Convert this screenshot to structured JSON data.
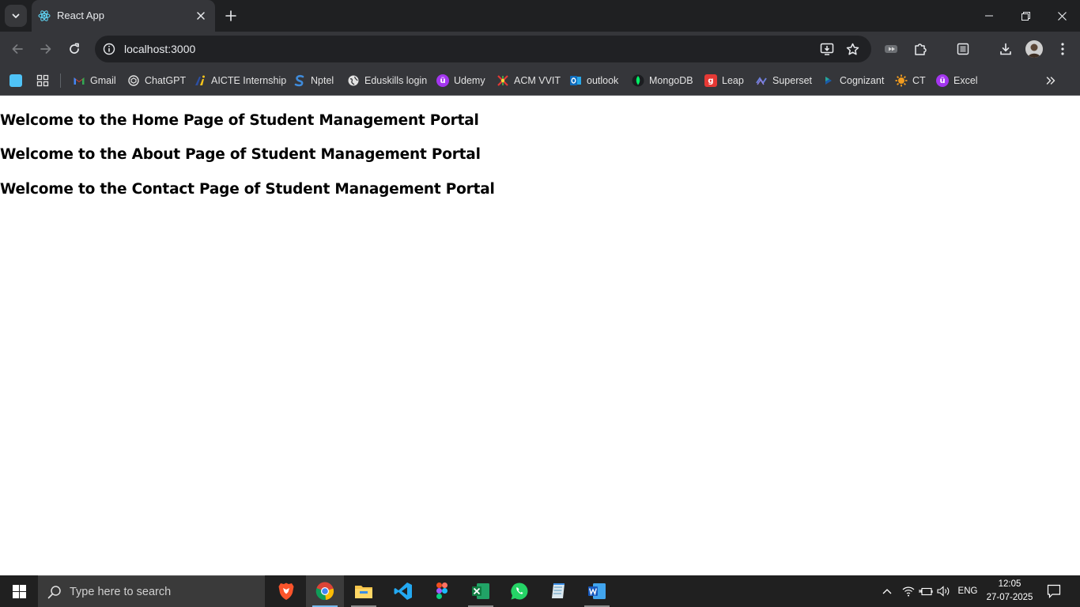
{
  "browser": {
    "tab": {
      "title": "React App",
      "favicon": "react-logo-icon"
    },
    "address": {
      "url": "localhost:3000"
    },
    "bookmarks": [
      {
        "label": "",
        "icon": "app-square-icon",
        "color": "#4fc3f7"
      },
      {
        "label": "",
        "icon": "apps-grid-icon",
        "color": "#e3e3e3"
      },
      {
        "label": "Gmail",
        "icon": "gmail-icon",
        "color": "#ea4335"
      },
      {
        "label": "ChatGPT",
        "icon": "chatgpt-icon",
        "color": "#e3e3e3"
      },
      {
        "label": "AICTE Internship",
        "icon": "aicte-icon",
        "color": "#f9c51c"
      },
      {
        "label": "Nptel",
        "icon": "nptel-icon",
        "color": "#3f8bdb"
      },
      {
        "label": "Eduskills login",
        "icon": "globe-icon",
        "color": "#e3e3e3"
      },
      {
        "label": "Udemy",
        "icon": "udemy-icon",
        "color": "#a435f0"
      },
      {
        "label": "ACM VVIT",
        "icon": "acm-icon",
        "color": "#2e7d32"
      },
      {
        "label": "outlook",
        "icon": "outlook-icon",
        "color": "#0f6cbd"
      },
      {
        "label": "MongoDB",
        "icon": "mongodb-icon",
        "color": "#00ed64"
      },
      {
        "label": "Leap",
        "icon": "leap-icon",
        "color": "#e53935"
      },
      {
        "label": "Superset",
        "icon": "superset-icon",
        "color": "#6a5acd"
      },
      {
        "label": "Cognizant",
        "icon": "cognizant-icon",
        "color": "#1a5aa8"
      },
      {
        "label": "CT",
        "icon": "gear-sun-icon",
        "color": "#f29c1f"
      },
      {
        "label": "Excel",
        "icon": "udemy-icon",
        "color": "#a435f0"
      }
    ]
  },
  "page": {
    "headings": [
      "Welcome to the Home Page of Student Management Portal",
      "Welcome to the About Page of Student Management Portal",
      "Welcome to the Contact Page of Student Management Portal"
    ]
  },
  "taskbar": {
    "search_placeholder": "Type here to search",
    "apps": [
      "brave",
      "chrome",
      "file-explorer",
      "vscode",
      "figma",
      "excel",
      "whatsapp",
      "notepad",
      "word"
    ],
    "language": "ENG",
    "time": "12:05",
    "date": "27-07-2025"
  }
}
